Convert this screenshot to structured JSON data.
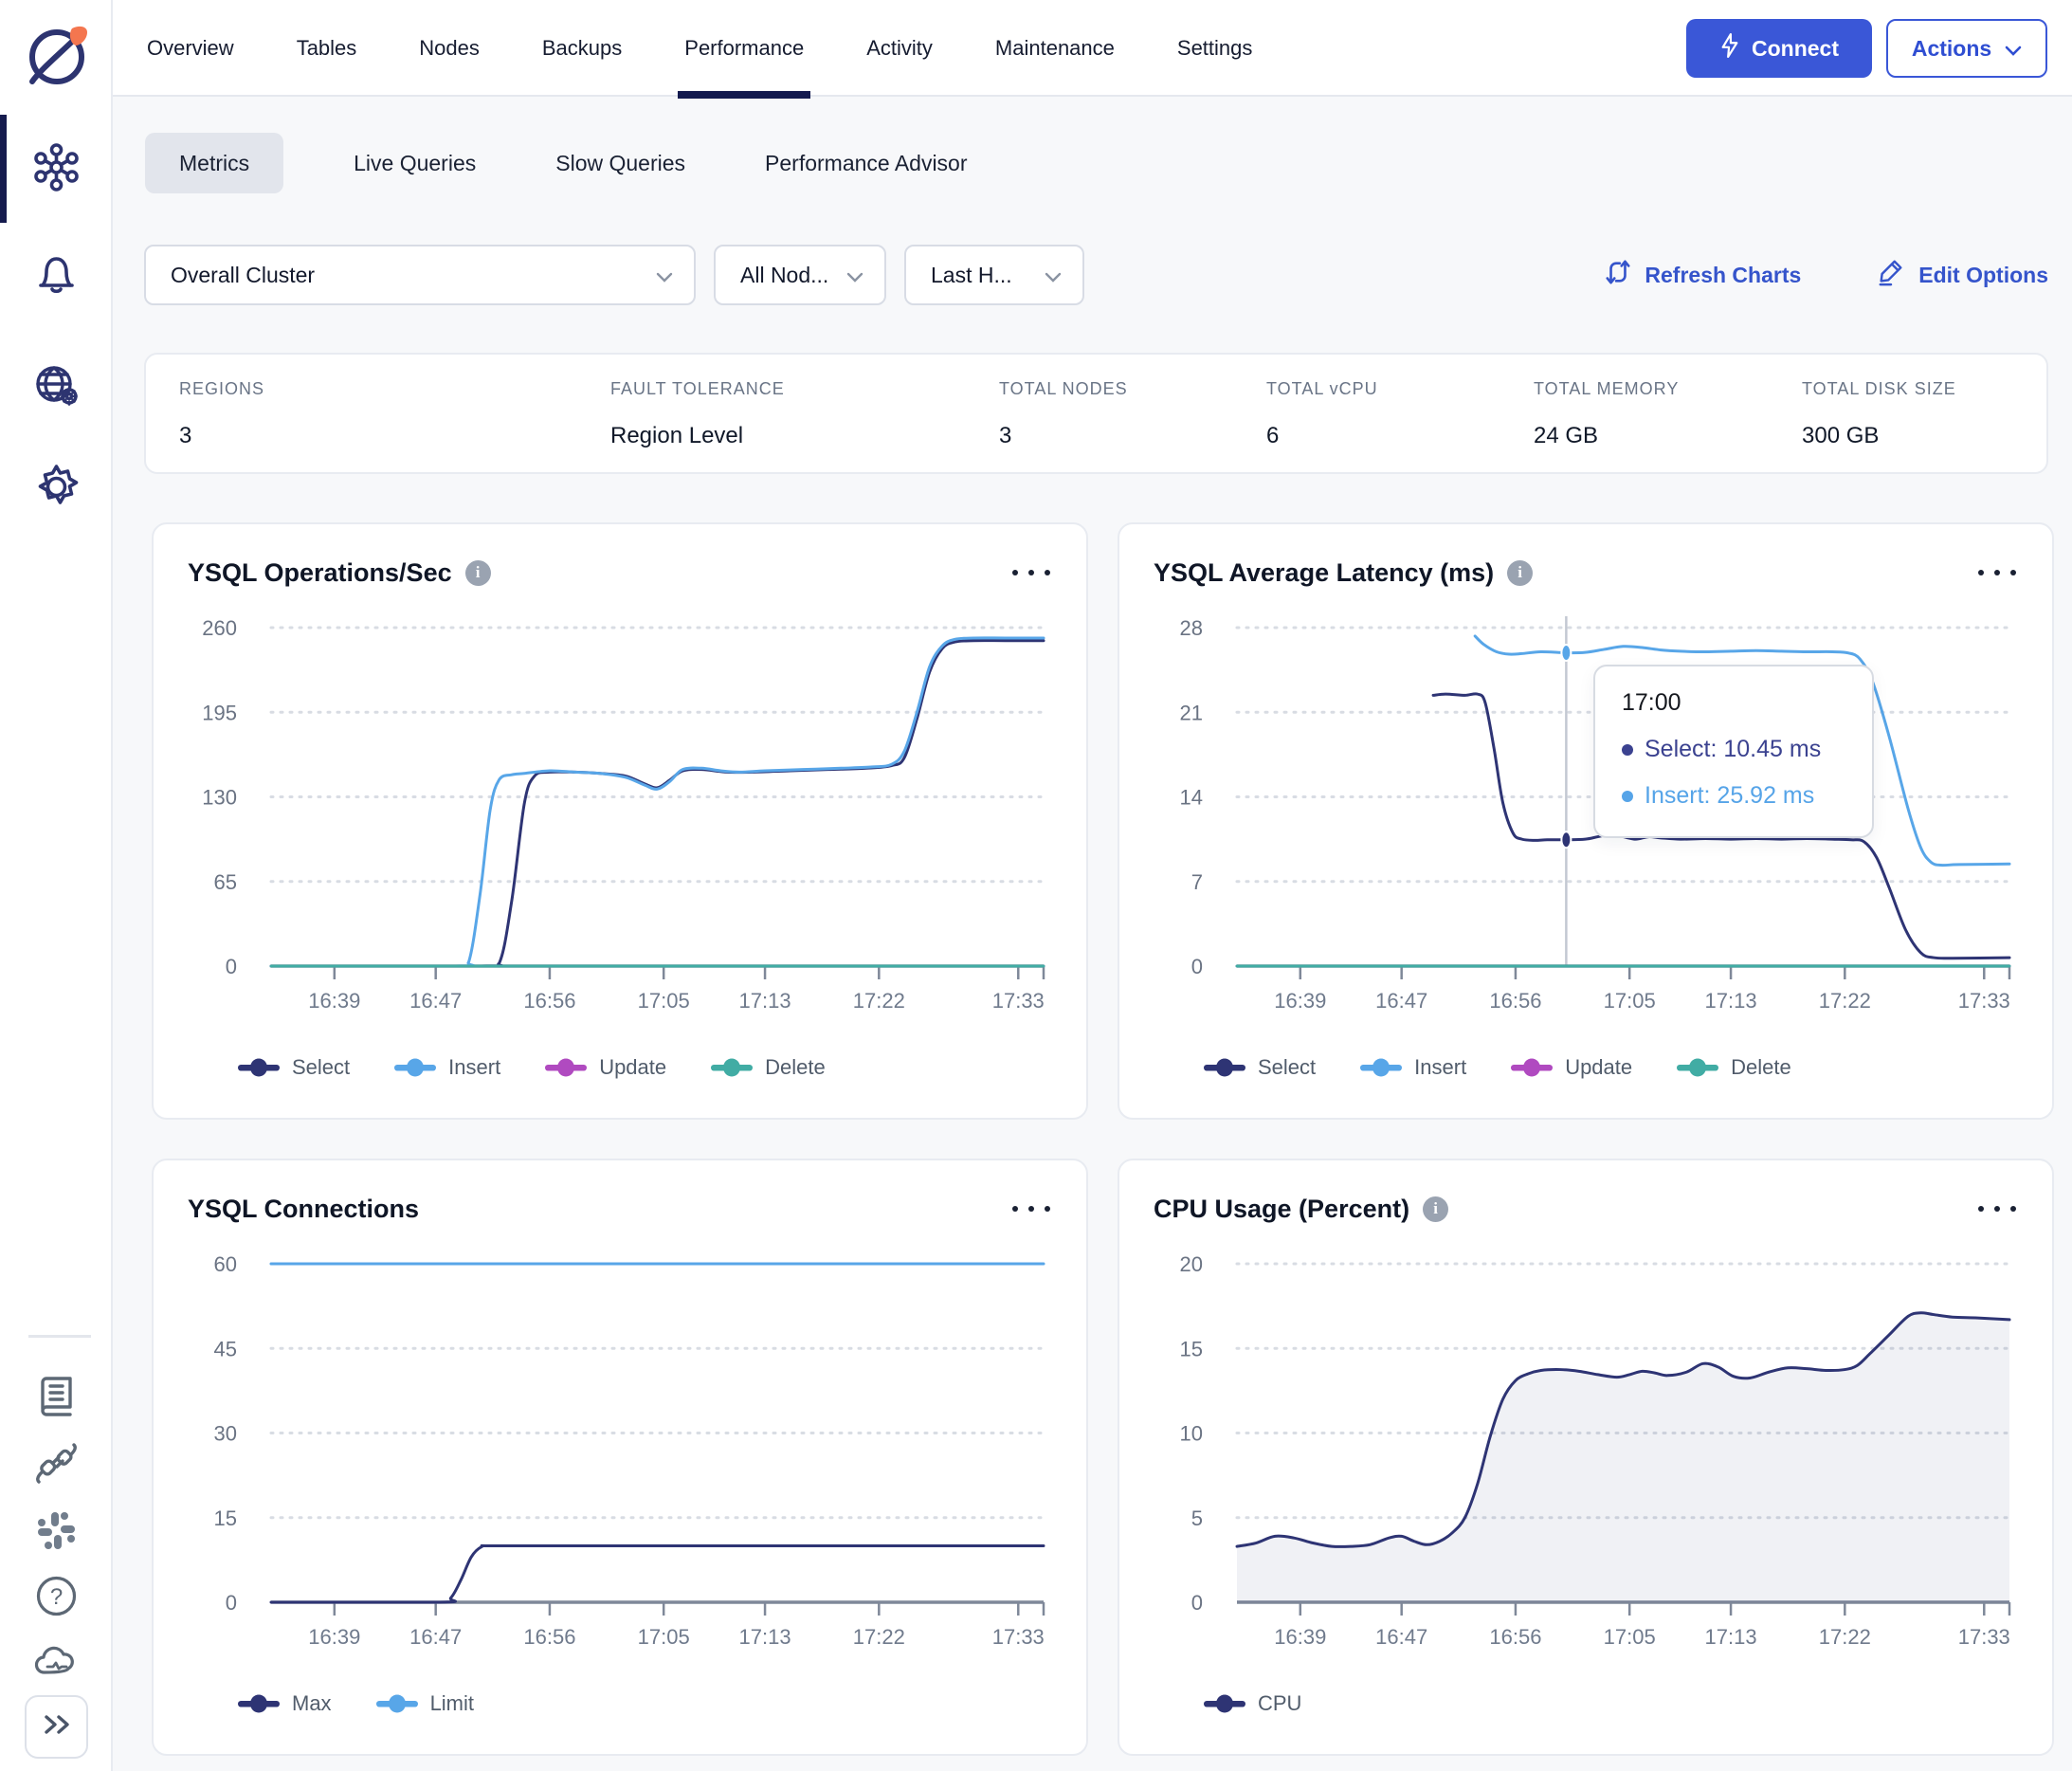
{
  "colors": {
    "accent_blue": "#3a57d7",
    "link_blue": "#3554cb",
    "active_navy": "#141a4f",
    "series_navy": "#2e3474",
    "series_blue": "#58a6e8",
    "series_magenta": "#b04ac0",
    "series_teal": "#41aca4",
    "cpu_fill": "rgba(46,52,116,0.07)",
    "axis": "#7f8899",
    "grid": "#d8dce3",
    "card_border": "#e8ebf1"
  },
  "sidebar": {
    "icons": [
      "logo",
      "cluster",
      "notifications",
      "network-settings",
      "settings",
      "docs",
      "integrations",
      "slack",
      "help",
      "cloud-status",
      "expand"
    ]
  },
  "topnav": {
    "tabs": [
      {
        "label": "Overview",
        "active": false
      },
      {
        "label": "Tables",
        "active": false
      },
      {
        "label": "Nodes",
        "active": false
      },
      {
        "label": "Backups",
        "active": false
      },
      {
        "label": "Performance",
        "active": true
      },
      {
        "label": "Activity",
        "active": false
      },
      {
        "label": "Maintenance",
        "active": false
      },
      {
        "label": "Settings",
        "active": false
      }
    ],
    "connect_label": "Connect",
    "actions_label": "Actions"
  },
  "subtabs": {
    "items": [
      {
        "label": "Metrics",
        "active": true
      },
      {
        "label": "Live Queries",
        "active": false
      },
      {
        "label": "Slow Queries",
        "active": false
      },
      {
        "label": "Performance Advisor",
        "active": false
      }
    ]
  },
  "filters": {
    "cluster": "Overall Cluster",
    "nodes": "All Nod...",
    "range": "Last H...",
    "refresh_label": "Refresh Charts",
    "edit_label": "Edit Options"
  },
  "stats": {
    "items": [
      {
        "label": "REGIONS",
        "value": "3"
      },
      {
        "label": "FAULT TOLERANCE",
        "value": "Region Level"
      },
      {
        "label": "TOTAL NODES",
        "value": "3"
      },
      {
        "label": "TOTAL vCPU",
        "value": "6"
      },
      {
        "label": "TOTAL MEMORY",
        "value": "24 GB"
      },
      {
        "label": "TOTAL DISK SIZE",
        "value": "300 GB"
      }
    ]
  },
  "chart_data": [
    {
      "type": "line",
      "title": "YSQL Operations/Sec",
      "has_info": true,
      "ylim": [
        0,
        260
      ],
      "yticks": [
        260,
        195,
        130,
        65,
        0
      ],
      "xticks": [
        [
          39,
          "16:39"
        ],
        [
          47,
          "16:47"
        ],
        [
          56,
          "16:56"
        ],
        [
          65,
          "17:05"
        ],
        [
          73,
          "17:13"
        ],
        [
          82,
          "17:22"
        ],
        [
          93,
          "17:33"
        ]
      ],
      "grid": true,
      "legend_position": "bottom",
      "series": [
        {
          "name": "Select",
          "color": "#2e3474",
          "points": [
            [
              34,
              0
            ],
            [
              50.5,
              0
            ],
            [
              52,
              2
            ],
            [
              53,
              50
            ],
            [
              54,
              125
            ],
            [
              54.8,
              146
            ],
            [
              56,
              149
            ],
            [
              58,
              149
            ],
            [
              60,
              148
            ],
            [
              62,
              146
            ],
            [
              63.5,
              140
            ],
            [
              64.5,
              137
            ],
            [
              65.5,
              143
            ],
            [
              66.5,
              150
            ],
            [
              68,
              151
            ],
            [
              70,
              149
            ],
            [
              72,
              149
            ],
            [
              75,
              150
            ],
            [
              78,
              151
            ],
            [
              81,
              152
            ],
            [
              83,
              154
            ],
            [
              84,
              160
            ],
            [
              85,
              190
            ],
            [
              86,
              226
            ],
            [
              87,
              244
            ],
            [
              88,
              249
            ],
            [
              89.5,
              250
            ],
            [
              92,
              250
            ],
            [
              95,
              250
            ]
          ]
        },
        {
          "name": "Insert",
          "color": "#58a6e8",
          "points": [
            [
              34,
              0
            ],
            [
              48.6,
              0
            ],
            [
              49.6,
              3
            ],
            [
              50.5,
              55
            ],
            [
              51.3,
              120
            ],
            [
              52,
              143
            ],
            [
              53,
              147
            ],
            [
              54,
              148
            ],
            [
              56,
              150
            ],
            [
              58,
              149
            ],
            [
              60,
              148
            ],
            [
              62,
              145
            ],
            [
              63.5,
              139
            ],
            [
              64.5,
              136
            ],
            [
              65.5,
              142
            ],
            [
              66.5,
              151
            ],
            [
              68,
              152
            ],
            [
              69.5,
              150
            ],
            [
              71,
              149
            ],
            [
              73,
              150
            ],
            [
              76,
              151
            ],
            [
              79,
              152
            ],
            [
              81.5,
              153
            ],
            [
              83,
              155
            ],
            [
              84,
              165
            ],
            [
              85,
              195
            ],
            [
              86,
              230
            ],
            [
              87,
              246
            ],
            [
              88,
              251
            ],
            [
              89.5,
              252
            ],
            [
              92,
              252
            ],
            [
              95,
              252
            ]
          ]
        },
        {
          "name": "Update",
          "color": "#b04ac0",
          "points": [
            [
              34,
              0
            ],
            [
              95,
              0
            ]
          ]
        },
        {
          "name": "Delete",
          "color": "#41aca4",
          "points": [
            [
              34,
              0
            ],
            [
              95,
              0
            ]
          ]
        }
      ]
    },
    {
      "type": "line",
      "title": "YSQL Average Latency (ms)",
      "has_info": true,
      "ylim": [
        0,
        28
      ],
      "yticks": [
        28,
        21,
        14,
        7,
        0
      ],
      "xticks": [
        [
          39,
          "16:39"
        ],
        [
          47,
          "16:47"
        ],
        [
          56,
          "16:56"
        ],
        [
          65,
          "17:05"
        ],
        [
          73,
          "17:13"
        ],
        [
          82,
          "17:22"
        ],
        [
          93,
          "17:33"
        ]
      ],
      "grid": true,
      "legend_position": "bottom",
      "crosshair": {
        "t": 60,
        "markers": [
          {
            "series": 0,
            "v": 10.45
          },
          {
            "series": 1,
            "v": 25.92
          }
        ]
      },
      "tooltip": {
        "time": "17:00",
        "rows": [
          {
            "text": "Select: 10.45 ms",
            "color": "#3b4290"
          },
          {
            "text": "Insert: 25.92 ms",
            "color": "#56a4e8"
          }
        ]
      },
      "series": [
        {
          "name": "Select",
          "color": "#2e3474",
          "points": [
            [
              49.5,
              22.4
            ],
            [
              50.5,
              22.5
            ],
            [
              52,
              22.4
            ],
            [
              53,
              22.5
            ],
            [
              53.6,
              21.8
            ],
            [
              54.3,
              18
            ],
            [
              55,
              13.5
            ],
            [
              55.8,
              11
            ],
            [
              56.5,
              10.5
            ],
            [
              57.5,
              10.4
            ],
            [
              58.5,
              10.45
            ],
            [
              60,
              10.45
            ],
            [
              61.5,
              10.5
            ],
            [
              62.5,
              10.7
            ],
            [
              63.5,
              10.9
            ],
            [
              64.5,
              10.7
            ],
            [
              65.5,
              10.5
            ],
            [
              66.5,
              10.7
            ],
            [
              67.5,
              10.6
            ],
            [
              69,
              10.5
            ],
            [
              71,
              10.55
            ],
            [
              73,
              10.5
            ],
            [
              75,
              10.55
            ],
            [
              77,
              10.5
            ],
            [
              79,
              10.55
            ],
            [
              81,
              10.5
            ],
            [
              82.5,
              10.45
            ],
            [
              83.5,
              10.3
            ],
            [
              84.5,
              9
            ],
            [
              85.5,
              6.5
            ],
            [
              86.8,
              3
            ],
            [
              88,
              1.1
            ],
            [
              89,
              0.7
            ],
            [
              90.5,
              0.65
            ],
            [
              95,
              0.7
            ]
          ]
        },
        {
          "name": "Insert",
          "color": "#58a6e8",
          "points": [
            [
              52.8,
              27.3
            ],
            [
              53.5,
              26.6
            ],
            [
              54.5,
              26
            ],
            [
              55.5,
              25.8
            ],
            [
              56.5,
              25.85
            ],
            [
              58,
              26
            ],
            [
              60,
              25.92
            ],
            [
              61.5,
              25.95
            ],
            [
              63,
              26.2
            ],
            [
              64.5,
              26.45
            ],
            [
              66,
              26.35
            ],
            [
              67.5,
              26.15
            ],
            [
              69,
              26.05
            ],
            [
              71,
              26
            ],
            [
              73,
              26.05
            ],
            [
              75,
              26.1
            ],
            [
              77,
              26.05
            ],
            [
              79,
              26
            ],
            [
              81,
              26
            ],
            [
              82.3,
              25.9
            ],
            [
              83.2,
              25.4
            ],
            [
              84.2,
              23.5
            ],
            [
              85.5,
              19
            ],
            [
              87,
              13
            ],
            [
              88,
              9.8
            ],
            [
              88.8,
              8.6
            ],
            [
              89.6,
              8.35
            ],
            [
              91,
              8.4
            ],
            [
              95,
              8.45
            ]
          ]
        },
        {
          "name": "Update",
          "color": "#b04ac0",
          "points": [
            [
              34,
              0
            ],
            [
              95,
              0
            ]
          ]
        },
        {
          "name": "Delete",
          "color": "#41aca4",
          "points": [
            [
              34,
              0
            ],
            [
              95,
              0
            ]
          ]
        }
      ]
    },
    {
      "type": "line",
      "title": "YSQL Connections",
      "has_info": false,
      "ylim": [
        0,
        60
      ],
      "yticks": [
        60,
        45,
        30,
        15,
        0
      ],
      "xticks": [
        [
          39,
          "16:39"
        ],
        [
          47,
          "16:47"
        ],
        [
          56,
          "16:56"
        ],
        [
          65,
          "17:05"
        ],
        [
          73,
          "17:13"
        ],
        [
          82,
          "17:22"
        ],
        [
          93,
          "17:33"
        ]
      ],
      "grid": true,
      "legend_position": "bottom",
      "series": [
        {
          "name": "Max",
          "color": "#2e3474",
          "points": [
            [
              34,
              0
            ],
            [
              47.3,
              0
            ],
            [
              48.2,
              0.8
            ],
            [
              49,
              4
            ],
            [
              49.8,
              8
            ],
            [
              50.6,
              9.8
            ],
            [
              51.6,
              10
            ],
            [
              60,
              10
            ],
            [
              70,
              10
            ],
            [
              80,
              10
            ],
            [
              95,
              10
            ]
          ]
        },
        {
          "name": "Limit",
          "color": "#58a6e8",
          "points": [
            [
              34,
              60
            ],
            [
              95,
              60
            ]
          ]
        }
      ]
    },
    {
      "type": "area",
      "title": "CPU Usage (Percent)",
      "has_info": true,
      "ylim": [
        0,
        20
      ],
      "yticks": [
        20,
        15,
        10,
        5,
        0
      ],
      "xticks": [
        [
          39,
          "16:39"
        ],
        [
          47,
          "16:47"
        ],
        [
          56,
          "16:56"
        ],
        [
          65,
          "17:05"
        ],
        [
          73,
          "17:13"
        ],
        [
          82,
          "17:22"
        ],
        [
          93,
          "17:33"
        ]
      ],
      "grid": true,
      "legend_position": "bottom",
      "series": [
        {
          "name": "CPU",
          "color": "#2e3474",
          "fill": "rgba(46,52,116,0.07)",
          "points": [
            [
              34,
              3.3
            ],
            [
              35.5,
              3.5
            ],
            [
              37,
              3.9
            ],
            [
              38.5,
              3.8
            ],
            [
              40,
              3.5
            ],
            [
              41.5,
              3.3
            ],
            [
              43,
              3.3
            ],
            [
              44.5,
              3.4
            ],
            [
              46,
              3.8
            ],
            [
              47,
              3.9
            ],
            [
              48,
              3.6
            ],
            [
              49,
              3.4
            ],
            [
              50,
              3.6
            ],
            [
              51,
              4.1
            ],
            [
              52,
              5
            ],
            [
              53,
              7
            ],
            [
              54,
              9.8
            ],
            [
              55,
              12
            ],
            [
              56,
              13.1
            ],
            [
              57,
              13.5
            ],
            [
              58,
              13.7
            ],
            [
              59.5,
              13.75
            ],
            [
              61,
              13.65
            ],
            [
              62.5,
              13.45
            ],
            [
              64,
              13.3
            ],
            [
              65,
              13.45
            ],
            [
              66,
              13.65
            ],
            [
              67,
              13.55
            ],
            [
              68,
              13.4
            ],
            [
              69.5,
              13.6
            ],
            [
              70.8,
              14.1
            ],
            [
              72,
              13.9
            ],
            [
              73.2,
              13.35
            ],
            [
              74.5,
              13.25
            ],
            [
              76,
              13.6
            ],
            [
              77.5,
              13.85
            ],
            [
              79,
              13.8
            ],
            [
              80.5,
              13.7
            ],
            [
              82,
              13.75
            ],
            [
              83,
              14
            ],
            [
              84,
              14.7
            ],
            [
              85.5,
              15.8
            ],
            [
              87,
              16.9
            ],
            [
              88,
              17.1
            ],
            [
              89,
              17
            ],
            [
              90.5,
              16.85
            ],
            [
              92.5,
              16.8
            ],
            [
              95,
              16.7
            ]
          ]
        }
      ]
    }
  ]
}
